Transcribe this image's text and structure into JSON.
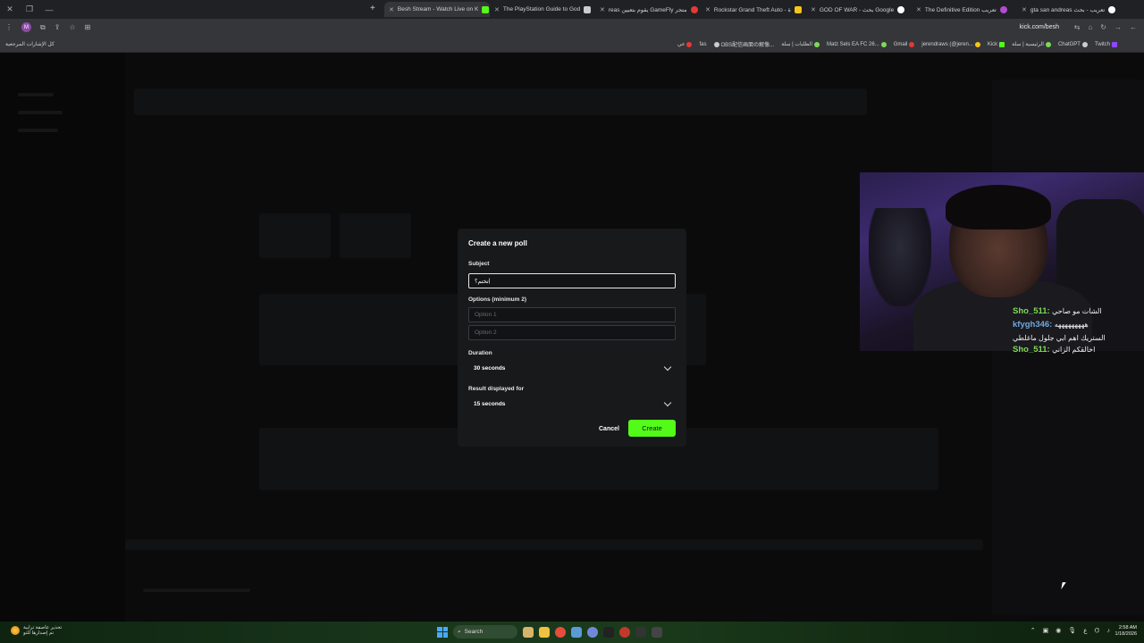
{
  "browser": {
    "tabs": [
      {
        "label": "Besh Stream - Watch Live on K",
        "favicon_color": "#53fc18",
        "active": true
      },
      {
        "label": "The PlayStation Guide to God",
        "favicon_color": "#cccccc",
        "active": false
      },
      {
        "label": "reas يقوم بتعيين GameFly متجر",
        "favicon_color": "#e53935",
        "active": false
      },
      {
        "label": "Rockstar Grand Theft Auto - ة",
        "favicon_color": "#f5c518",
        "active": false
      },
      {
        "label": "GOD OF WAR - بحث Google",
        "favicon_color": "#ffffff",
        "active": false
      },
      {
        "label": "The Definitive Edition تعريب",
        "favicon_color": "#b14ccf",
        "active": false
      },
      {
        "label": "gta san andreas تعريب - بحث",
        "favicon_color": "#ffffff",
        "active": false
      }
    ],
    "url": "kick.com/besh",
    "bookmarks_folder": "كل الإشارات المرجعية",
    "bookmarks": [
      {
        "label": "عي",
        "color": "#e53935"
      },
      {
        "label": "fas",
        "color": "#888888"
      },
      {
        "label": "OBS配信画面の解像...",
        "color": "#cccccc"
      },
      {
        "label": "الطلبات | سلة",
        "color": "#7ed957"
      },
      {
        "label": "Matz Sels EA FC 26...",
        "color": "#7ed957"
      },
      {
        "label": "Gmail",
        "color": "#e53935"
      },
      {
        "label": "jerendraws (@jeren...",
        "color": "#f5c518"
      },
      {
        "label": "Kick",
        "color": "#53fc18"
      },
      {
        "label": "الرئيسية | سلة",
        "color": "#7ed957"
      },
      {
        "label": "ChatGPT",
        "color": "#cccccc"
      },
      {
        "label": "Twitch",
        "color": "#9146ff"
      }
    ],
    "profile_initial": "M"
  },
  "chat_overlay": [
    {
      "user": "Sho_511:",
      "text": "الشات مو صاحي",
      "user_color": "#7ed957"
    },
    {
      "user": "kfygh346:",
      "text": "هههههههههه",
      "user_color": "#6fa8dc"
    },
    {
      "user": "",
      "text": "الستريك اهم ابي جلول ماغلطي",
      "user_color": "#f2f2f2"
    },
    {
      "user": "Sho_511:",
      "text": "اخالقكم الزاني",
      "user_color": "#7ed957"
    }
  ],
  "poll_modal": {
    "title": "Create a new poll",
    "subject_label": "Subject",
    "subject_value": "تختم؟",
    "options_label": "Options (minimum 2)",
    "option1_placeholder": "Option 1",
    "option2_placeholder": "Option 2",
    "duration_label": "Duration",
    "duration_value": "30 seconds",
    "result_label": "Result displayed for",
    "result_value": "15 seconds",
    "cancel_label": "Cancel",
    "create_label": "Create",
    "accent_color": "#53fc18"
  },
  "taskbar": {
    "weather_line1": "تحذير عاصفة ترابية",
    "weather_line2": "تم إصدارها للتو",
    "search_label": "Search",
    "time": "2:58 AM",
    "date": "1/18/2026"
  }
}
